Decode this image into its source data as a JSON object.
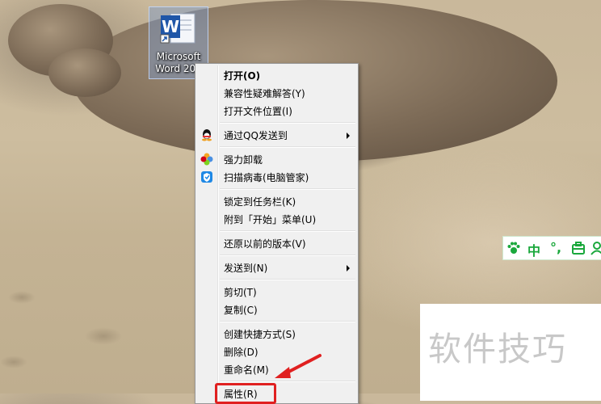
{
  "desktop": {
    "word_icon": {
      "label_line1": "Microsoft",
      "label_line2": "Word 201",
      "icon": "word-icon"
    }
  },
  "context_menu": {
    "items": [
      {
        "label": "打开(O)",
        "bold": true
      },
      {
        "label": "兼容性疑难解答(Y)"
      },
      {
        "label": "打开文件位置(I)"
      },
      {
        "label": "通过QQ发送到",
        "icon": "qq-icon",
        "submenu": true
      },
      {
        "label": "强力卸载",
        "icon": "pinwheel-icon"
      },
      {
        "label": "扫描病毒(电脑管家)",
        "icon": "shield-icon"
      },
      {
        "label": "锁定到任务栏(K)"
      },
      {
        "label": "附到「开始」菜单(U)"
      },
      {
        "label": "还原以前的版本(V)"
      },
      {
        "label": "发送到(N)",
        "submenu": true
      },
      {
        "label": "剪切(T)"
      },
      {
        "label": "复制(C)"
      },
      {
        "label": "创建快捷方式(S)"
      },
      {
        "label": "删除(D)"
      },
      {
        "label": "重命名(M)"
      },
      {
        "label": "属性(R)"
      }
    ]
  },
  "ime_bar": {
    "items": [
      "中",
      "°,",
      "⌂",
      "☺"
    ],
    "icons": [
      "paw-icon",
      "toolbox-icon",
      "user-icon"
    ],
    "color": "#1aa83c"
  },
  "watermark": {
    "text": "软件技巧"
  },
  "annotation": {
    "highlight_color": "#e02020"
  }
}
